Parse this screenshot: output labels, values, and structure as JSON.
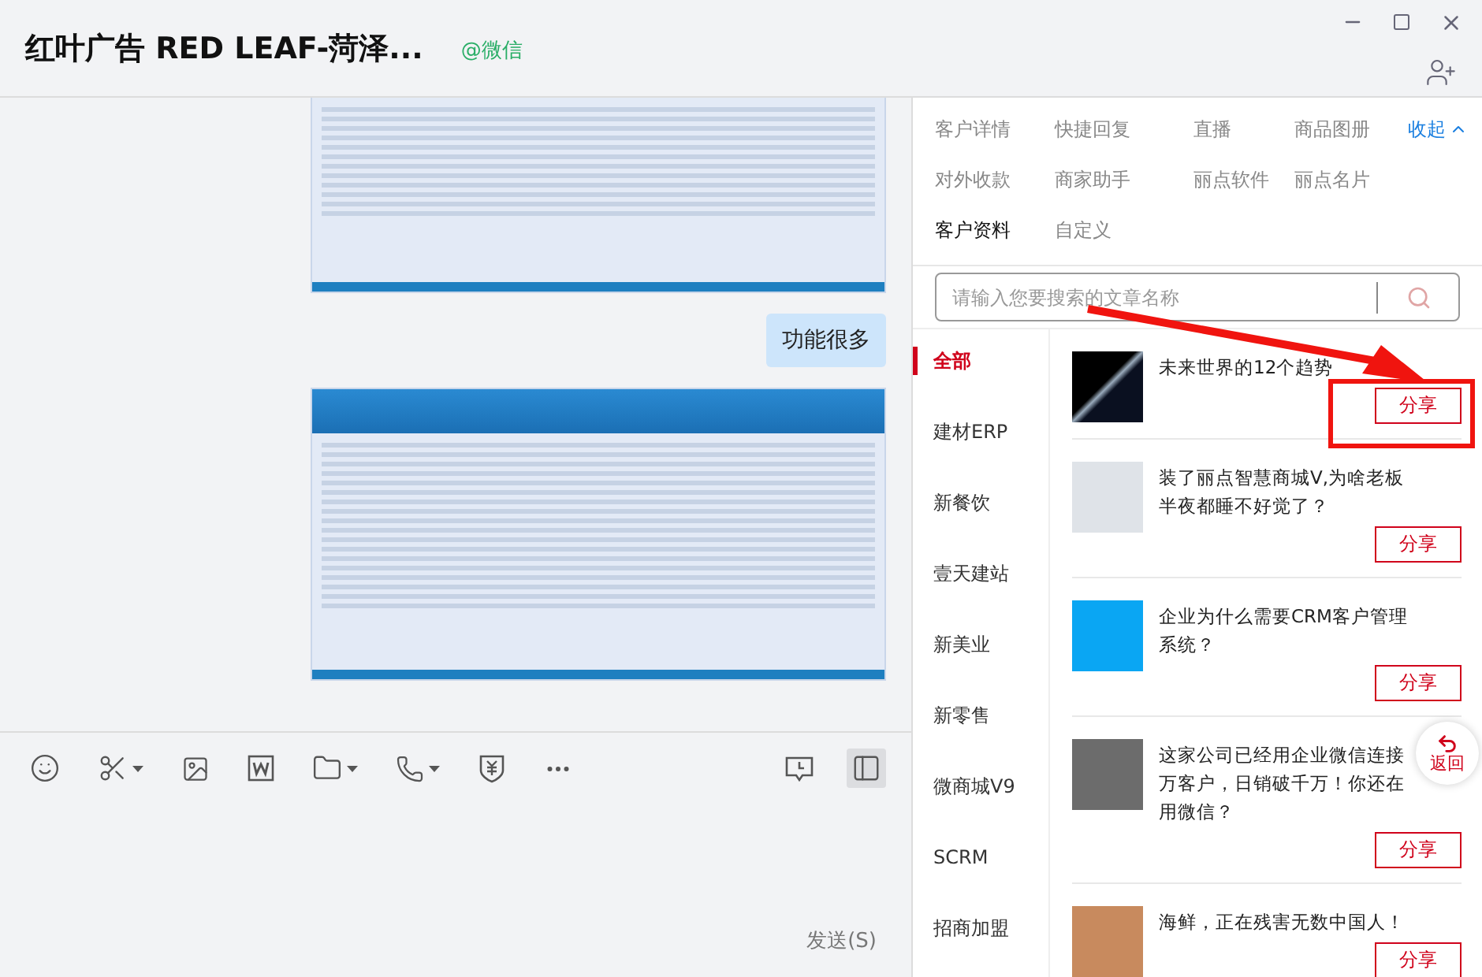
{
  "header": {
    "title": "红叶广告 RED LEAF-菏泽...",
    "source": "@微信"
  },
  "messages": [
    {
      "kind": "image",
      "cropped": true
    },
    {
      "kind": "text",
      "text": "功能很多"
    },
    {
      "kind": "image",
      "cropped": false
    }
  ],
  "composer": {
    "panel_toggle": {
      "selected": true
    },
    "send_label": "发送(S)"
  },
  "tabs": [
    {
      "label": "客户详情",
      "selected": false
    },
    {
      "label": "快捷回复",
      "selected": false
    },
    {
      "label": "直播",
      "selected": false
    },
    {
      "label": "商品图册",
      "selected": false
    },
    {
      "label": "对外收款",
      "selected": false
    },
    {
      "label": "商家助手",
      "selected": false
    },
    {
      "label": "丽点软件",
      "selected": false
    },
    {
      "label": "丽点名片",
      "selected": false
    },
    {
      "label": "客户资料",
      "selected": true
    },
    {
      "label": "自定义",
      "selected": false
    }
  ],
  "collapse_label": "收起",
  "search": {
    "placeholder": "请输入您要搜索的文章名称"
  },
  "categories": [
    {
      "label": "全部",
      "selected": true
    },
    {
      "label": "建材ERP",
      "selected": false
    },
    {
      "label": "新餐饮",
      "selected": false
    },
    {
      "label": "壹天建站",
      "selected": false
    },
    {
      "label": "新美业",
      "selected": false
    },
    {
      "label": "新零售",
      "selected": false
    },
    {
      "label": "微商城V9",
      "selected": false
    },
    {
      "label": "SCRM",
      "selected": false
    },
    {
      "label": "招商加盟",
      "selected": false
    }
  ],
  "articles": [
    {
      "title": "未来世界的12个趋势",
      "share": "分享"
    },
    {
      "title": "装了丽点智慧商城V,为啥老板半夜都睡不好觉了？",
      "share": "分享"
    },
    {
      "title": "企业为什么需要CRM客户管理系统？",
      "share": "分享"
    },
    {
      "title": "这家公司已经用企业微信连接万客户，日销破千万！你还在用微信？",
      "share": "分享"
    },
    {
      "title": "海鲜，正在残害无数中国人！",
      "share": "分享"
    }
  ],
  "return_label": "返回"
}
